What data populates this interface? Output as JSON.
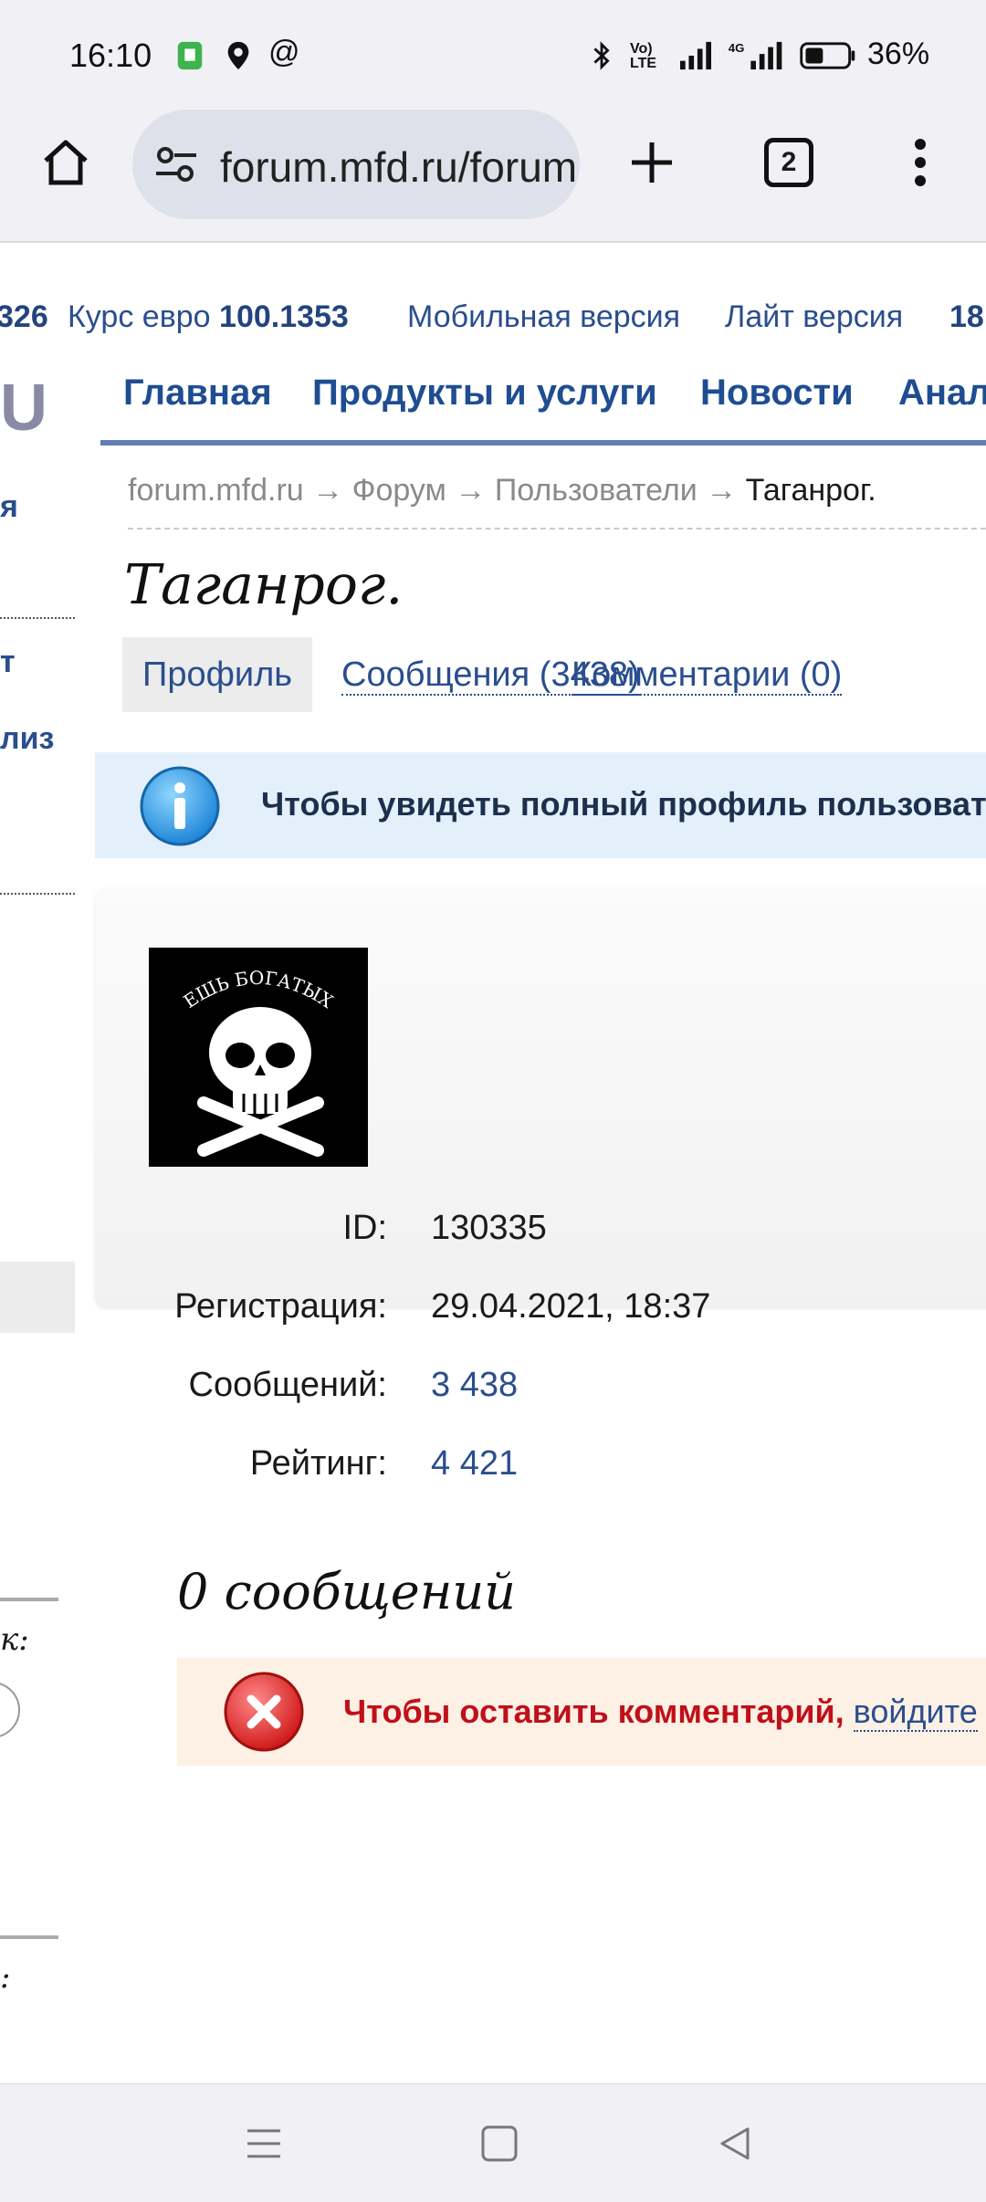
{
  "status_bar": {
    "time": "16:10",
    "battery": "36%",
    "icons": [
      "sim-icon",
      "location-icon",
      "at-icon",
      "bluetooth-icon",
      "volte-icon",
      "signal-icon",
      "4g-signal-icon",
      "battery-icon"
    ]
  },
  "browser": {
    "url": "forum.mfd.ru/forum/",
    "tab_count": "2",
    "icons": [
      "home-icon",
      "site-settings-icon",
      "new-tab-icon",
      "tab-switcher-icon",
      "menu-icon"
    ]
  },
  "ticker": {
    "prefix_value": "326",
    "euro_label": "Курс евро",
    "euro_value": "100.1353",
    "mobile_link": "Мобильная версия",
    "lite_link": "Лайт версия",
    "suffix_value": "18"
  },
  "left_column": {
    "logo_fragment": "U",
    "item1": "я",
    "item2": "т",
    "item3": "лиз",
    "item4": "к:",
    "item5": ":"
  },
  "nav": {
    "items": [
      "Главная",
      "Продукты и услуги",
      "Новости",
      "Анал"
    ]
  },
  "breadcrumb": {
    "items": [
      "forum.mfd.ru",
      "Форум",
      "Пользователи",
      "Таганрог."
    ],
    "separator": "→"
  },
  "profile": {
    "title": "Таганрог.",
    "tabs": {
      "profile": "Профиль",
      "messages": "Сообщения (3438)",
      "comments": "Комментарии (0)"
    },
    "info_text": "Чтобы увидеть полный профиль пользователя",
    "avatar_caption": "ЕШЬ БОГАТЫХ",
    "fields": [
      {
        "label": "ID:",
        "value": "130335"
      },
      {
        "label": "Регистрация:",
        "value": "29.04.2021, 18:37"
      },
      {
        "label": "Сообщений:",
        "value": "3 438"
      },
      {
        "label": "Рейтинг:",
        "value": "4 421"
      }
    ],
    "messages_count_title": "0 сообщений",
    "error_text": "Чтобы оставить комментарий,",
    "error_link": "войдите"
  },
  "colors": {
    "link": "#2a4e8e",
    "info_bg": "#e3f0fb",
    "error_bg": "#fdf0e4",
    "error_text": "#c0101a"
  },
  "navbar_icons": [
    "recent-apps-icon",
    "home-square-icon",
    "back-icon"
  ]
}
